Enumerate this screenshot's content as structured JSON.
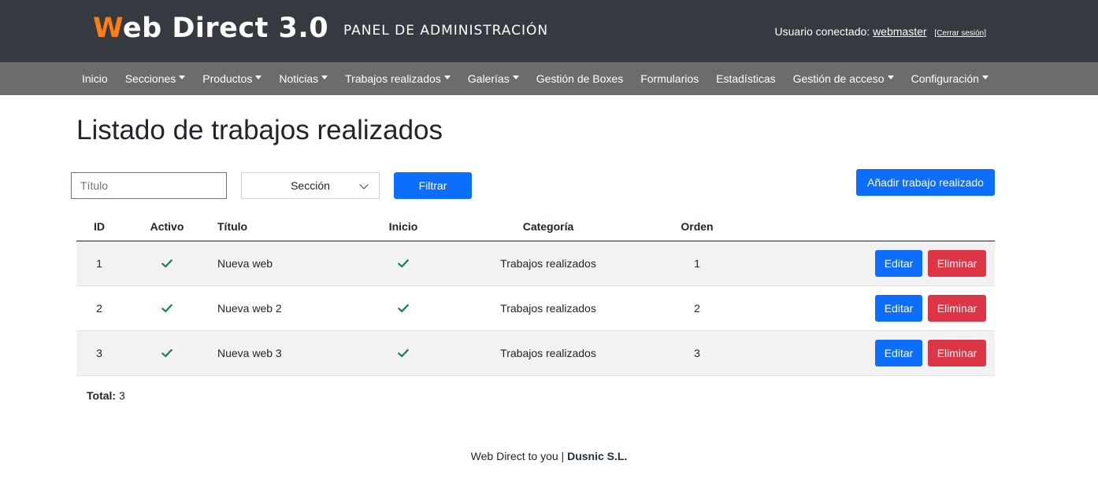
{
  "header": {
    "logo_first_letter": "W",
    "logo_rest": "eb Direct 3.0",
    "panel_label": "PANEL DE ADMINISTRACIÓN",
    "user_label": "Usuario conectado:",
    "username": "webmaster",
    "logout_label": "[Cerrar sesión]",
    "colors": {
      "background": "#343a40",
      "logo_accent": "#fd7e14"
    }
  },
  "nav": {
    "items": [
      {
        "label": "Inicio",
        "dropdown": false
      },
      {
        "label": "Secciones",
        "dropdown": true
      },
      {
        "label": "Productos",
        "dropdown": true
      },
      {
        "label": "Noticias",
        "dropdown": true
      },
      {
        "label": "Trabajos realizados",
        "dropdown": true
      },
      {
        "label": "Galerías",
        "dropdown": true
      },
      {
        "label": "Gestión de Boxes",
        "dropdown": false
      },
      {
        "label": "Formularios",
        "dropdown": false
      },
      {
        "label": "Estadísticas",
        "dropdown": false
      },
      {
        "label": "Gestión de acceso",
        "dropdown": true
      },
      {
        "label": "Configuración",
        "dropdown": true
      }
    ],
    "colors": {
      "background": "#6c6c6c"
    }
  },
  "main": {
    "title": "Listado de trabajos realizados",
    "filters": {
      "title_placeholder": "Título",
      "section_selected": "Sección",
      "filter_label": "Filtrar"
    },
    "add_label": "Añadir trabajo realizado",
    "table": {
      "headers": {
        "id": "ID",
        "active": "Activo",
        "title": "Título",
        "home": "Inicio",
        "category": "Categoría",
        "order": "Orden"
      },
      "rows": [
        {
          "id": "1",
          "active": true,
          "title": "Nueva web",
          "home": true,
          "category": "Trabajos realizados",
          "order": "1"
        },
        {
          "id": "2",
          "active": true,
          "title": "Nueva web 2",
          "home": true,
          "category": "Trabajos realizados",
          "order": "2"
        },
        {
          "id": "3",
          "active": true,
          "title": "Nueva web 3",
          "home": true,
          "category": "Trabajos realizados",
          "order": "3"
        }
      ],
      "edit_label": "Editar",
      "delete_label": "Eliminar"
    },
    "total_label": "Total:",
    "total_value": "3",
    "colors": {
      "primary": "#0d6efd",
      "danger": "#dc3545",
      "check": "#198754"
    }
  },
  "footer": {
    "text": "Web Direct to you |",
    "company": "Dusnic S.L."
  }
}
